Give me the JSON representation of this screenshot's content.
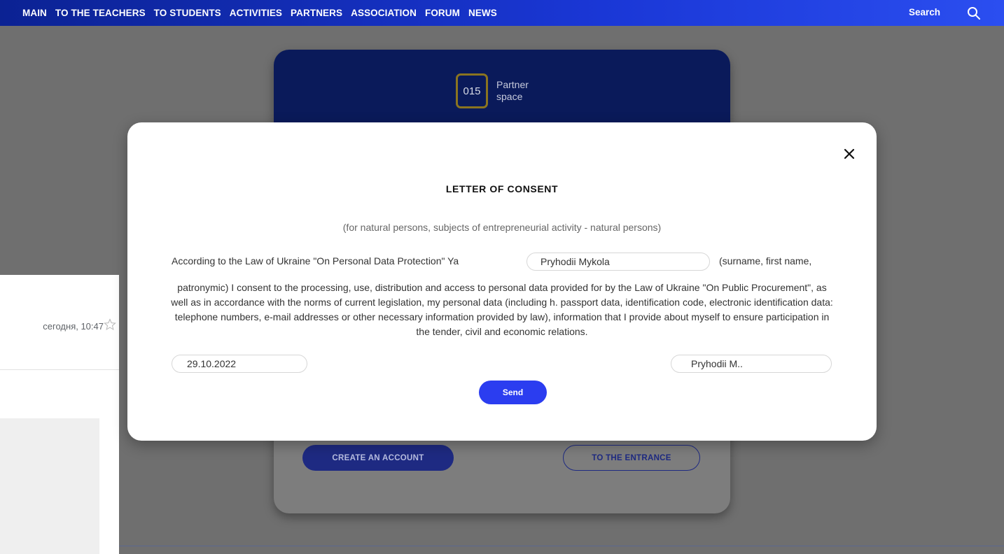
{
  "nav": {
    "items": [
      {
        "label": "MAIN"
      },
      {
        "label": "TO THE TEACHERS"
      },
      {
        "label": "TO STUDENTS"
      },
      {
        "label": "ACTIVITIES"
      },
      {
        "label": "PARTNERS"
      },
      {
        "label": "ASSOCIATION"
      },
      {
        "label": "FORUM"
      },
      {
        "label": "NEWS"
      }
    ],
    "search_label": "Search",
    "search_icon": "search-icon"
  },
  "email_panel": {
    "date": "сегодня, 10:47",
    "star_icon": "star-outline-icon"
  },
  "partner_card": {
    "logo_number": "015",
    "logo_line1": "Partner",
    "logo_line2": "space",
    "create_account_label": "CREATE AN ACCOUNT",
    "entrance_label": "TO THE ENTRANCE"
  },
  "modal": {
    "close_icon": "close-icon",
    "title": "LETTER OF CONSENT",
    "subtitle": "(for natural persons, subjects of entrepreneurial activity - natural persons)",
    "line1_prefix": "According to the Law of Ukraine \"On Personal Data Protection\" Ya",
    "name_value": "Pryhodii Mykola",
    "line1_suffix": "(surname, first name,",
    "body_text": "patronymic) I consent to the processing, use, distribution and access to personal data provided for by the Law of Ukraine \"On Public Procurement\", as well as in accordance with the norms of current legislation, my personal data (including h. passport data, identification code, electronic identification data: telephone numbers, e-mail addresses or other necessary information provided by law), information that I provide about myself to ensure participation in the tender, civil and economic relations.",
    "date_value": "29.10.2022",
    "signature_value": "Pryhodii M..",
    "send_label": "Send"
  },
  "colors": {
    "nav_gradient_start": "#0b2293",
    "nav_gradient_end": "#2b4ef0",
    "send_button": "#2b3df0",
    "overlay_gray": "#6f6f6f"
  }
}
